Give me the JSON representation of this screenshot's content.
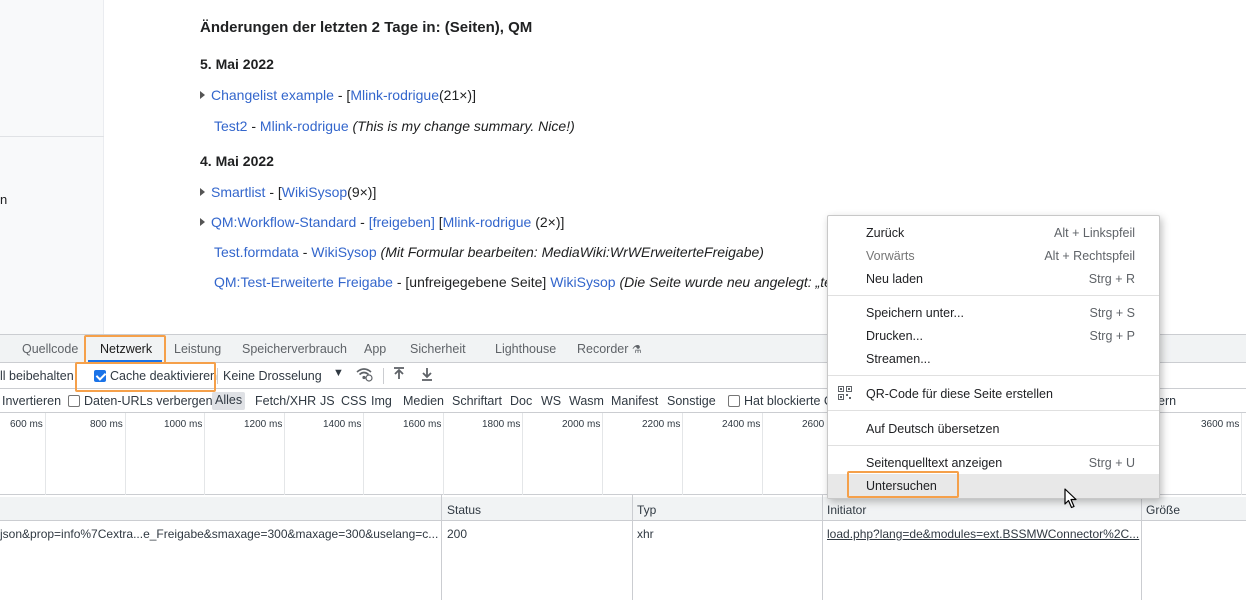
{
  "wiki": {
    "left_fragment": "n",
    "title": "Änderungen der letzten 2 Tage in: (Seiten), QM",
    "days": [
      {
        "label": "5. Mai 2022",
        "entries": [
          {
            "page": "Changelist example",
            "sep": " - ",
            "open": "[",
            "user": "Mlink-rodrigue",
            "count": "(21×)",
            "close": "]"
          },
          {
            "page": "Test2",
            "sep": " - ",
            "user": "Mlink-rodrigue",
            "summary": "(This is my change summary. Nice!)"
          }
        ]
      },
      {
        "label": "4. Mai 2022",
        "entries": [
          {
            "page": "Smartlist",
            "sep": " - ",
            "open": "[",
            "user": "WikiSysop",
            "count": "(9×)",
            "close": "]"
          },
          {
            "page": "QM:Workflow-Standard",
            "sep": " - ",
            "status": "[freigeben]",
            "open": "[",
            "user": "Mlink-rodrigue",
            "count": "(2×)",
            "close": "]"
          },
          {
            "page": "Test.formdata",
            "sep": " - ",
            "user": "WikiSysop",
            "summary": "(Mit Formular bearbeiten: MediaWiki:WrWErweiterteFreigabe)"
          },
          {
            "page": "QM:Test-Erweiterte Freigabe",
            "sep": " - ",
            "status": "[unfreigegebene Seite]",
            "user": "WikiSysop",
            "summary": "(Die Seite wurde neu angelegt: „test“)"
          }
        ]
      }
    ]
  },
  "devtools": {
    "tabs": [
      "Quellcode",
      "Netzwerk",
      "Leistung",
      "Speicherverbrauch",
      "App",
      "Sicherheit",
      "Lighthouse",
      "Recorder"
    ],
    "active_tab": "Netzwerk",
    "toolbar": {
      "preserve_log": "ll beibehalten",
      "disable_cache": "Cache deaktivieren",
      "disable_cache_checked": true,
      "throttling": "Keine Drosselung"
    },
    "filters": {
      "invert": "Invertieren",
      "hide_data_urls": "Daten-URLs verbergen",
      "types": [
        "Alles",
        "Fetch/XHR",
        "JS",
        "CSS",
        "Img",
        "Medien",
        "Schriftart",
        "Doc",
        "WS",
        "Wasm",
        "Manifest",
        "Sonstige"
      ],
      "blocked": "Hat blockierte C",
      "tail": "ern"
    },
    "timeline_ticks": [
      "600 ms",
      "800 ms",
      "1000 ms",
      "1200 ms",
      "1400 ms",
      "1600 ms",
      "1800 ms",
      "2000 ms",
      "2200 ms",
      "2400 ms",
      "2600",
      "3600 ms"
    ],
    "columns": [
      "Status",
      "Typ",
      "Initiator",
      "Größe"
    ],
    "rows": [
      {
        "name": "json&prop=info%7Cextra...e_Freigabe&smaxage=300&maxage=300&uselang=c...",
        "status": "200",
        "type": "xhr",
        "initiator": "load.php?lang=de&modules=ext.BSSMWConnector%2C...",
        "size": ""
      }
    ]
  },
  "context_menu": {
    "items": [
      {
        "label": "Zurück",
        "shortcut": "Alt + Linkspfeil"
      },
      {
        "label": "Vorwärts",
        "shortcut": "Alt + Rechtspfeil",
        "disabled": true
      },
      {
        "label": "Neu laden",
        "shortcut": "Strg + R"
      },
      {
        "label": "Speichern unter...",
        "shortcut": "Strg + S"
      },
      {
        "label": "Drucken...",
        "shortcut": "Strg + P"
      },
      {
        "label": "Streamen..."
      },
      {
        "label": "QR-Code für diese Seite erstellen",
        "icon": "qr-code-icon"
      },
      {
        "label": "Auf Deutsch übersetzen"
      },
      {
        "label": "Seitenquelltext anzeigen",
        "shortcut": "Strg + U"
      },
      {
        "label": "Untersuchen",
        "highlighted": true
      }
    ]
  },
  "colors": {
    "link": "#3366cc",
    "highlight_box": "#f5a04a",
    "tab_active_underline": "#1a73e8",
    "checkbox_checked": "#1a73e8"
  }
}
